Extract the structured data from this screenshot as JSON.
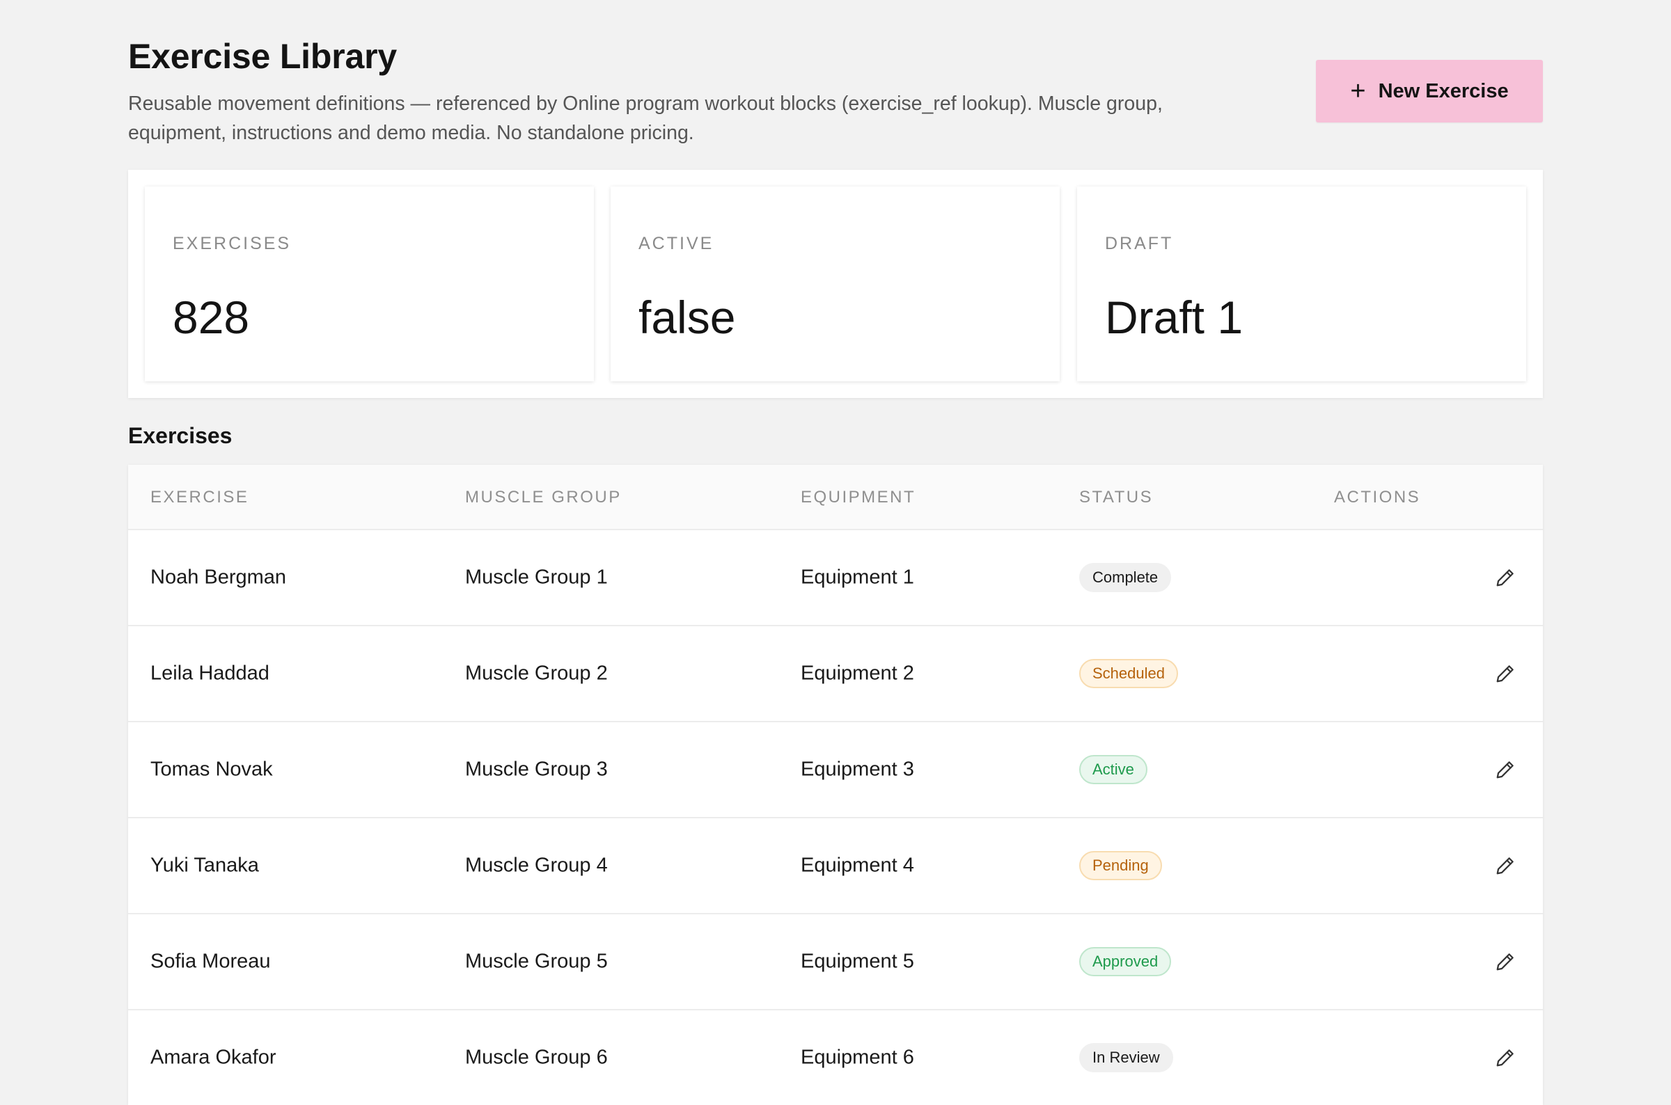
{
  "header": {
    "title": "Exercise Library",
    "description": "Reusable movement definitions — referenced by Online program workout blocks (exercise_ref lookup). Muscle group, equipment, instructions and demo media. No standalone pricing.",
    "new_button_label": "New Exercise"
  },
  "stats": [
    {
      "label": "EXERCISES",
      "value": "828"
    },
    {
      "label": "ACTIVE",
      "value": "false"
    },
    {
      "label": "DRAFT",
      "value": "Draft 1"
    }
  ],
  "section_title": "Exercises",
  "table": {
    "columns": [
      "EXERCISE",
      "MUSCLE GROUP",
      "EQUIPMENT",
      "STATUS",
      "ACTIONS"
    ],
    "rows": [
      {
        "exercise": "Noah Bergman",
        "muscle_group": "Muscle Group 1",
        "equipment": "Equipment 1",
        "status": "Complete"
      },
      {
        "exercise": "Leila Haddad",
        "muscle_group": "Muscle Group 2",
        "equipment": "Equipment 2",
        "status": "Scheduled"
      },
      {
        "exercise": "Tomas Novak",
        "muscle_group": "Muscle Group 3",
        "equipment": "Equipment 3",
        "status": "Active"
      },
      {
        "exercise": "Yuki Tanaka",
        "muscle_group": "Muscle Group 4",
        "equipment": "Equipment 4",
        "status": "Pending"
      },
      {
        "exercise": "Sofia Moreau",
        "muscle_group": "Muscle Group 5",
        "equipment": "Equipment 5",
        "status": "Approved"
      },
      {
        "exercise": "Amara Okafor",
        "muscle_group": "Muscle Group 6",
        "equipment": "Equipment 6",
        "status": "In Review"
      }
    ]
  },
  "icons": {
    "new_button": "plus-icon",
    "row_action": "pencil-icon"
  },
  "colors": {
    "accent": "#f7c1d8",
    "badge_neutral_bg": "#f0f0f0",
    "badge_neutral_fg": "#1a1a1a",
    "badge_warning_bg": "#fff4e3",
    "badge_warning_fg": "#b5620c",
    "badge_warning_border": "#f8dcb0",
    "badge_success_bg": "#e9f7ee",
    "badge_success_fg": "#1e9a4c",
    "badge_success_border": "#bfe6cc"
  }
}
